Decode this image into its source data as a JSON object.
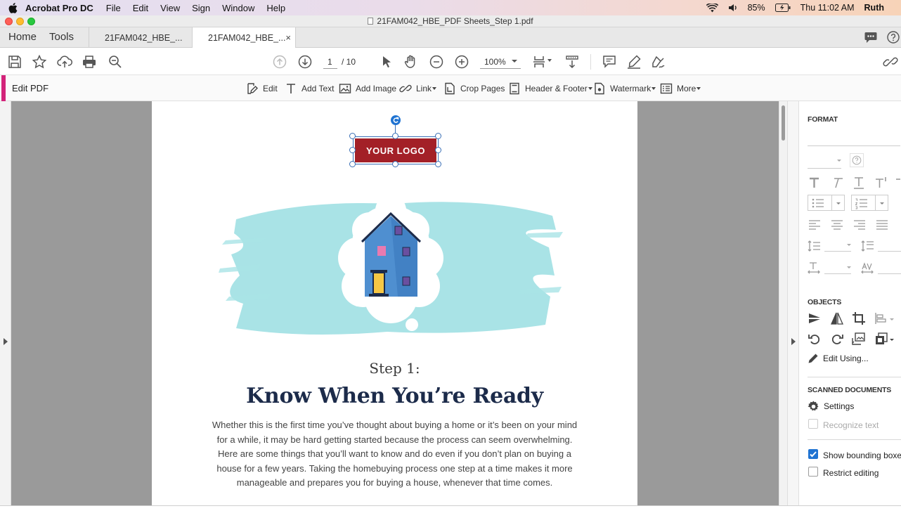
{
  "menubar": {
    "app_name": "Acrobat Pro DC",
    "items": [
      "File",
      "Edit",
      "View",
      "Sign",
      "Window",
      "Help"
    ],
    "battery": "85%",
    "clock": "Thu 11:02 AM",
    "user": "Ruth"
  },
  "window": {
    "title": "21FAM042_HBE_PDF Sheets_Step 1.pdf"
  },
  "tabs": {
    "home": "Home",
    "tools": "Tools",
    "doc1": "21FAM042_HBE_...",
    "doc2": "21FAM042_HBE_...",
    "close": "×"
  },
  "toolbar": {
    "page_current": "1",
    "page_total": "/ 10",
    "zoom": "100%"
  },
  "editbar": {
    "label": "Edit PDF",
    "edit": "Edit",
    "add_text": "Add Text",
    "add_image": "Add Image",
    "link": "Link",
    "crop_pages": "Crop Pages",
    "header_footer": "Header & Footer",
    "watermark": "Watermark",
    "more": "More"
  },
  "document": {
    "logo_text": "YOUR LOGO",
    "step": "Step 1:",
    "heading": "Know When You’re Ready",
    "body_lines": [
      "Whether this is the first time you’ve thought about buying a home or it’s been on your mind",
      "for a while, it may be hard getting started because the process can seem overwhelming.",
      "Here are some things that you’ll want to know and do even if you don’t plan on buying a",
      "house for a few years. Taking the homebuying process one step at a time makes it more",
      "manageable and prepares you for buying a house, whenever that time comes."
    ],
    "colors": {
      "logo_red": "#a32027",
      "heading_navy": "#1c2b4a",
      "splash_teal": "#a9e3e6"
    }
  },
  "rightpanel": {
    "format_header": "FORMAT",
    "objects_header": "OBJECTS",
    "edit_using": "Edit Using...",
    "scanned_header": "SCANNED DOCUMENTS",
    "settings": "Settings",
    "recognize_text": "Recognize text",
    "show_bounding": "Show bounding boxes",
    "show_bounding_checked": true,
    "restrict_editing": "Restrict editing",
    "restrict_editing_checked": false
  }
}
